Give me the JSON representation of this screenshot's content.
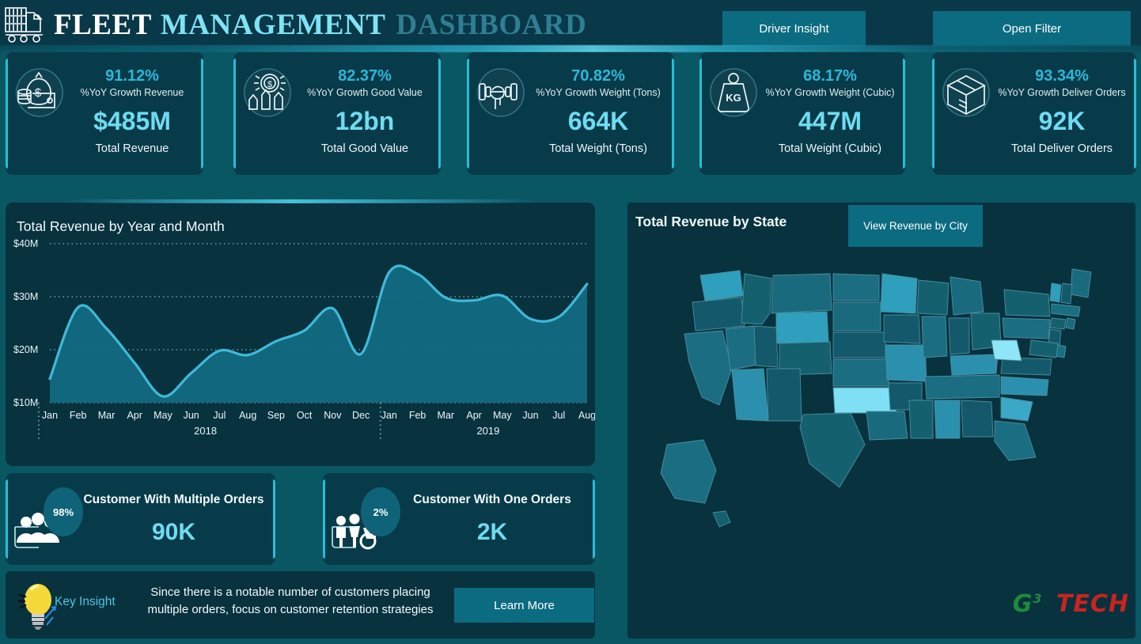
{
  "header": {
    "title_part1": "FLEET",
    "title_part2": "MANAGEMENT",
    "title_part3": "DASHBOARD",
    "driver_insight_label": "Driver Insight",
    "open_filter_label": "Open Filter"
  },
  "kpis": [
    {
      "icon": "money-bag-icon",
      "pct": "91.12%",
      "pct_label": "%YoY Growth Revenue",
      "value": "$485M",
      "label": "Total Revenue"
    },
    {
      "icon": "growth-coin-icon",
      "pct": "82.37%",
      "pct_label": "%YoY Growth Good Value",
      "value": "12bn",
      "label": "Total Good Value"
    },
    {
      "icon": "dumbbell-icon",
      "pct": "70.82%",
      "pct_label": "%YoY Growth Weight (Tons)",
      "value": "664K",
      "label": "Total Weight (Tons)"
    },
    {
      "icon": "weight-kg-icon",
      "pct": "68.17%",
      "pct_label": "%YoY Growth Weight (Cubic)",
      "value": "447M",
      "label": "Total Weight (Cubic)"
    },
    {
      "icon": "open-box-icon",
      "pct": "93.34%",
      "pct_label": "%YoY Growth Deliver Orders",
      "value": "92K",
      "label": "Total Deliver Orders"
    }
  ],
  "chart_panel": {
    "title": "Total Revenue by Year and Month"
  },
  "chart_data": {
    "type": "area",
    "title": "Total Revenue by Year and Month",
    "xlabel": "",
    "ylabel": "",
    "ylim": [
      10,
      40
    ],
    "ytick_labels": [
      "$40M",
      "$30M",
      "$20M",
      "$10M"
    ],
    "ytick_values": [
      40,
      30,
      20,
      10
    ],
    "grid": true,
    "legend": "none",
    "year_groups": [
      {
        "year": "2018",
        "months": [
          "Jan",
          "Feb",
          "Mar",
          "Apr",
          "May",
          "Jun",
          "Jul",
          "Aug",
          "Sep",
          "Oct",
          "Nov",
          "Dec"
        ]
      },
      {
        "year": "2019",
        "months": [
          "Jan",
          "Feb",
          "Mar",
          "Apr",
          "May",
          "Jun",
          "Jul",
          "Aug"
        ]
      }
    ],
    "categories": [
      "Jan 2018",
      "Feb 2018",
      "Mar 2018",
      "Apr 2018",
      "May 2018",
      "Jun 2018",
      "Jul 2018",
      "Aug 2018",
      "Sep 2018",
      "Oct 2018",
      "Nov 2018",
      "Dec 2018",
      "Jan 2019",
      "Feb 2019",
      "Mar 2019",
      "Apr 2019",
      "May 2019",
      "Jun 2019",
      "Jul 2019",
      "Aug 2019"
    ],
    "values": [
      14.5,
      28.0,
      24.0,
      17.5,
      11.2,
      15.6,
      19.8,
      19.0,
      21.6,
      23.6,
      27.8,
      19.2,
      34.6,
      34.3,
      29.8,
      29.3,
      30.2,
      25.8,
      26.2,
      32.4
    ],
    "series": [
      {
        "name": "Total Revenue",
        "values": [
          14.5,
          28.0,
          24.0,
          17.5,
          11.2,
          15.6,
          19.8,
          19.0,
          21.6,
          23.6,
          27.8,
          19.2,
          34.6,
          34.3,
          29.8,
          29.3,
          30.2,
          25.8,
          26.2,
          32.4
        ]
      }
    ],
    "units": "$M",
    "line_color": "#29a8c6",
    "fill_color": "#126b82"
  },
  "customer_cards": [
    {
      "icon": "group-people-icon",
      "badge": "98%",
      "title": "Customer With Multiple Orders",
      "value": "90K"
    },
    {
      "icon": "single-people-icon",
      "badge": "2%",
      "title": "Customer With One Orders",
      "value": "2K"
    }
  ],
  "insight": {
    "icon": "lightbulb-icon",
    "label": "Key Insight",
    "text": "Since there is a notable number of customers placing multiple orders, focus on customer retention strategies",
    "button_label": "Learn More"
  },
  "map_panel": {
    "title": "Total Revenue by State",
    "button_label": "View Revenue by City",
    "highlight_states": [
      "West Virginia",
      "Oklahoma",
      "South Carolina",
      "Minnesota",
      "Wyoming",
      "Arizona",
      "Washington"
    ],
    "colors": {
      "low": "#0d4a5b",
      "mid": "#1b6d82",
      "high": "#2e9fbc",
      "top": "#7fe0f5",
      "border": "#4a8fa0"
    }
  },
  "brand": {
    "part1": "G",
    "sup": "3",
    "part2": "TECH"
  },
  "theme": {
    "page_bg": "#0a5764",
    "header_bg": "#093848",
    "panel_bg": "#07323e",
    "card_bg": "#083b49",
    "accent": "#2bbcd6",
    "accent_light": "#6fdcf2",
    "button_bg": "#0b6b80"
  }
}
